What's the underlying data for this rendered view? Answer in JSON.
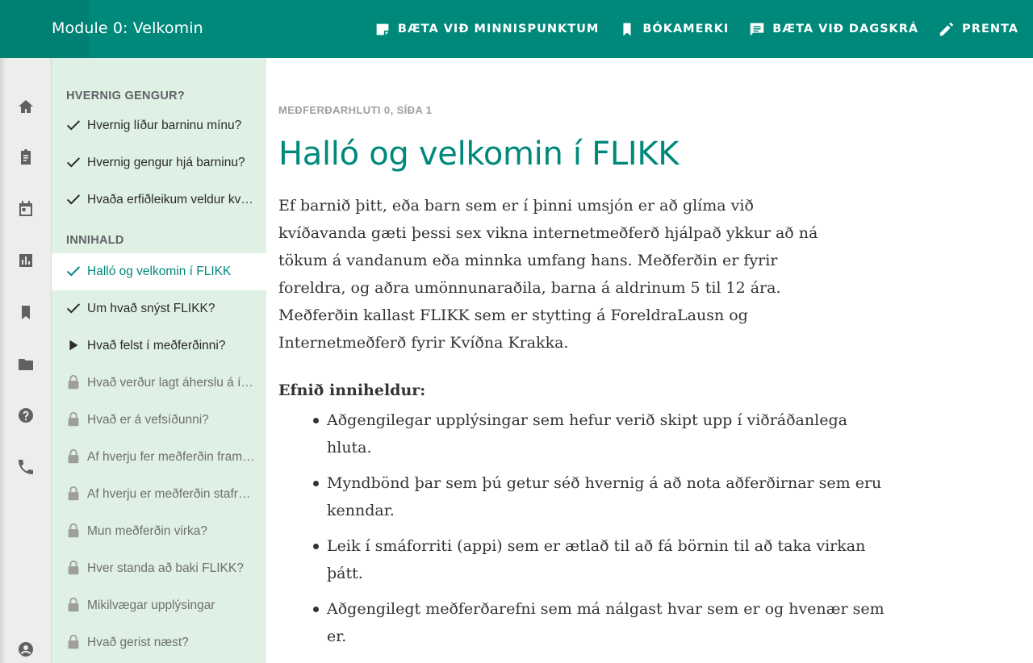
{
  "header": {
    "title": "Module 0: Velkomin",
    "actions": [
      {
        "label": "BÆTA VIÐ MINNISPUNKTUM",
        "icon": "note-add-icon"
      },
      {
        "label": "BÓKAMERKI",
        "icon": "bookmark-icon"
      },
      {
        "label": "BÆTA VIÐ DAGSKRÁ",
        "icon": "comment-icon"
      },
      {
        "label": "PRENTA",
        "icon": "pencil-icon"
      }
    ]
  },
  "rail": {
    "icons": [
      "home-icon",
      "clipboard-icon",
      "calendar-icon",
      "chart-icon",
      "bookmark-icon",
      "folder-icon",
      "help-icon",
      "phone-icon",
      "account-icon"
    ]
  },
  "sidebar": {
    "section1": "HVERNIG GENGUR?",
    "section1_items": [
      {
        "label": "Hvernig líður barninu mínu?",
        "status": "done"
      },
      {
        "label": "Hvernig gengur hjá barninu?",
        "status": "done"
      },
      {
        "label": "Hvaða erfiðleikum veldur kvíðinn?",
        "status": "done"
      }
    ],
    "section2": "INNIHALD",
    "section2_items": [
      {
        "label": "Halló og velkomin í FLIKK",
        "status": "done-active"
      },
      {
        "label": "Um hvað snýst FLIKK?",
        "status": "done"
      },
      {
        "label": "Hvað felst í meðferðinni?",
        "status": "current"
      },
      {
        "label": "Hvað verður lagt áherslu á í meðferðinni?",
        "status": "locked"
      },
      {
        "label": "Hvað er á vefsíðunni?",
        "status": "locked"
      },
      {
        "label": "Af hverju fer meðferðin fram á netinu?",
        "status": "locked"
      },
      {
        "label": "Af hverju er meðferðin stafræn?",
        "status": "locked"
      },
      {
        "label": "Mun meðferðin virka?",
        "status": "locked"
      },
      {
        "label": "Hver standa að baki FLIKK?",
        "status": "locked"
      },
      {
        "label": "Mikilvægar upplýsingar",
        "status": "locked"
      },
      {
        "label": "Hvað gerist næst?",
        "status": "locked"
      }
    ]
  },
  "content": {
    "breadcrumb": "MEÐFERÐARHLUTI 0, SÍÐA 1",
    "title": "Halló og velkomin í FLIKK",
    "intro_lines": [
      "Ef barnið þitt, eða barn sem er í þinni umsjón er að glíma við",
      "kvíðavanda gæti þessi sex vikna internetmeðferð hjálpað ykkur að ná",
      "tökum á vandanum eða minnka umfang hans. Meðferðin er fyrir",
      "foreldra, og aðra umönnunaraðila, barna á aldrinum 5 til 12 ára.",
      "Meðferðin kallast FLIKK sem er stytting á ForeldraLausn og",
      "Internetmeðferð fyrir Kvíðna Krakka."
    ],
    "subheading": "Efnið inniheldur:",
    "bullets": [
      "Aðgengilegar upplýsingar sem hefur verið skipt upp í viðráðanlega hluta.",
      "Myndbönd þar sem þú getur séð hvernig á að nota aðferðirnar sem eru kenndar.",
      "Leik í smáforriti (appi) sem er ætlað til að fá börnin til að taka virkan þátt.",
      "Aðgengilegt meðferðarefni sem má nálgast hvar sem er og hvenær sem er."
    ]
  },
  "colors": {
    "primary": "#00897b",
    "sidebar_bg": "#dff0e4",
    "rail_bg": "#eceeeb"
  }
}
